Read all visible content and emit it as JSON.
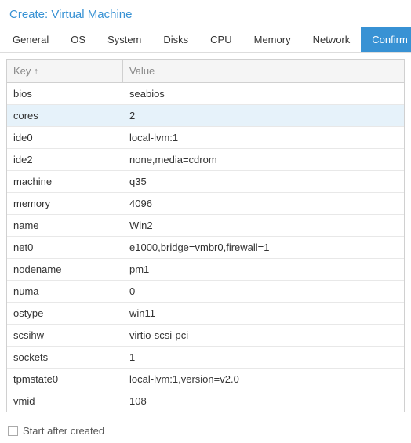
{
  "dialog": {
    "title": "Create: Virtual Machine"
  },
  "tabs": [
    {
      "label": "General"
    },
    {
      "label": "OS"
    },
    {
      "label": "System"
    },
    {
      "label": "Disks"
    },
    {
      "label": "CPU"
    },
    {
      "label": "Memory"
    },
    {
      "label": "Network"
    },
    {
      "label": "Confirm"
    }
  ],
  "grid": {
    "headers": {
      "key": "Key",
      "sort": "↑",
      "value": "Value"
    },
    "rows": [
      {
        "key": "bios",
        "value": "seabios"
      },
      {
        "key": "cores",
        "value": "2"
      },
      {
        "key": "ide0",
        "value": "local-lvm:1"
      },
      {
        "key": "ide2",
        "value": "none,media=cdrom"
      },
      {
        "key": "machine",
        "value": "q35"
      },
      {
        "key": "memory",
        "value": "4096"
      },
      {
        "key": "name",
        "value": "Win2"
      },
      {
        "key": "net0",
        "value": "e1000,bridge=vmbr0,firewall=1"
      },
      {
        "key": "nodename",
        "value": "pm1"
      },
      {
        "key": "numa",
        "value": "0"
      },
      {
        "key": "ostype",
        "value": "win11"
      },
      {
        "key": "scsihw",
        "value": "virtio-scsi-pci"
      },
      {
        "key": "sockets",
        "value": "1"
      },
      {
        "key": "tpmstate0",
        "value": "local-lvm:1,version=v2.0"
      },
      {
        "key": "vmid",
        "value": "108"
      }
    ],
    "selected_index": 1
  },
  "footer": {
    "checkbox_label": "Start after created"
  }
}
